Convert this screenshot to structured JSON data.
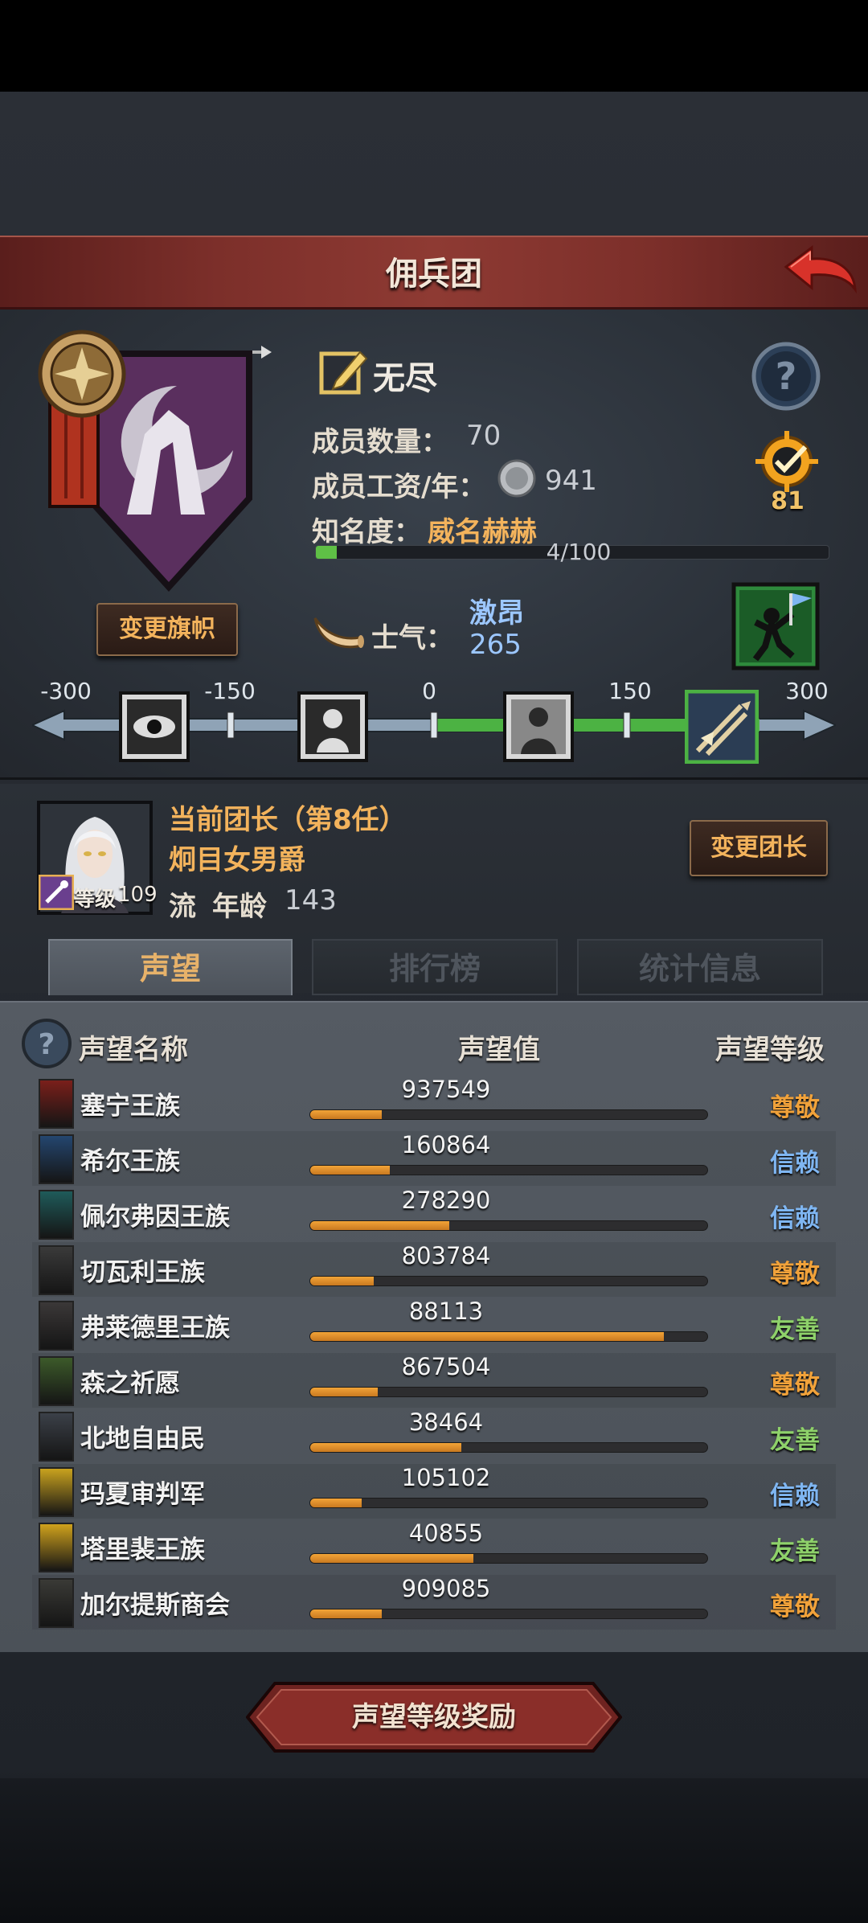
{
  "title": "佣兵团",
  "company": {
    "name": "无尽",
    "members_label": "成员数量：",
    "members_value": "70",
    "salary_label": "成员工资/年：",
    "salary_value": "941",
    "fame_label": "知名度：",
    "fame_value": "威名赫赫",
    "fame_progress_text": "4/100",
    "fame_progress": 0.04,
    "badge_count": "81",
    "change_flag_label": "变更旗帜"
  },
  "morale": {
    "label": "士气：",
    "state": "激昂",
    "value": "265",
    "ticks": [
      "-300",
      "-150",
      "0",
      "150",
      "300"
    ],
    "level_fraction": 0.94
  },
  "leader": {
    "title": "当前团长（第8任）",
    "name": "炯目女男爵",
    "level_label": "等级",
    "level_value": "109",
    "class": "流",
    "age_label": "年龄",
    "age_value": "143",
    "change_leader_label": "变更团长"
  },
  "tabs": [
    {
      "label": "声望"
    },
    {
      "label": "排行榜"
    },
    {
      "label": "统计信息"
    }
  ],
  "columns": {
    "name": "声望名称",
    "value": "声望值",
    "level": "声望等级"
  },
  "reputation": [
    {
      "name": "塞宁王族",
      "value": "937549",
      "fill": 0.18,
      "level": "尊敬",
      "level_color": "#f1a23a",
      "icon_color": "#7a1f1a"
    },
    {
      "name": "希尔王族",
      "value": "160864",
      "fill": 0.2,
      "level": "信赖",
      "level_color": "#7fb6f2",
      "icon_color": "#24466f"
    },
    {
      "name": "佩尔弗因王族",
      "value": "278290",
      "fill": 0.35,
      "level": "信赖",
      "level_color": "#7fb6f2",
      "icon_color": "#1f5b5a"
    },
    {
      "name": "切瓦利王族",
      "value": "803784",
      "fill": 0.16,
      "level": "尊敬",
      "level_color": "#f1a23a",
      "icon_color": "#3a3a3a"
    },
    {
      "name": "弗莱德里王族",
      "value": "88113",
      "fill": 0.89,
      "level": "友善",
      "level_color": "#8ed16a",
      "icon_color": "#3b3838"
    },
    {
      "name": "森之祈愿",
      "value": "867504",
      "fill": 0.17,
      "level": "尊敬",
      "level_color": "#f1a23a",
      "icon_color": "#3c5a2a"
    },
    {
      "name": "北地自由民",
      "value": "38464",
      "fill": 0.38,
      "level": "友善",
      "level_color": "#8ed16a",
      "icon_color": "#3b4048"
    },
    {
      "name": "玛夏审判军",
      "value": "105102",
      "fill": 0.13,
      "level": "信赖",
      "level_color": "#7fb6f2",
      "icon_color": "#c9a21e"
    },
    {
      "name": "塔里裴王族",
      "value": "40855",
      "fill": 0.41,
      "level": "友善",
      "level_color": "#8ed16a",
      "icon_color": "#d0a21c"
    },
    {
      "name": "加尔提斯商会",
      "value": "909085",
      "fill": 0.18,
      "level": "尊敬",
      "level_color": "#f1a23a",
      "icon_color": "#3a3a36"
    }
  ],
  "reward_button": "声望等级奖励"
}
